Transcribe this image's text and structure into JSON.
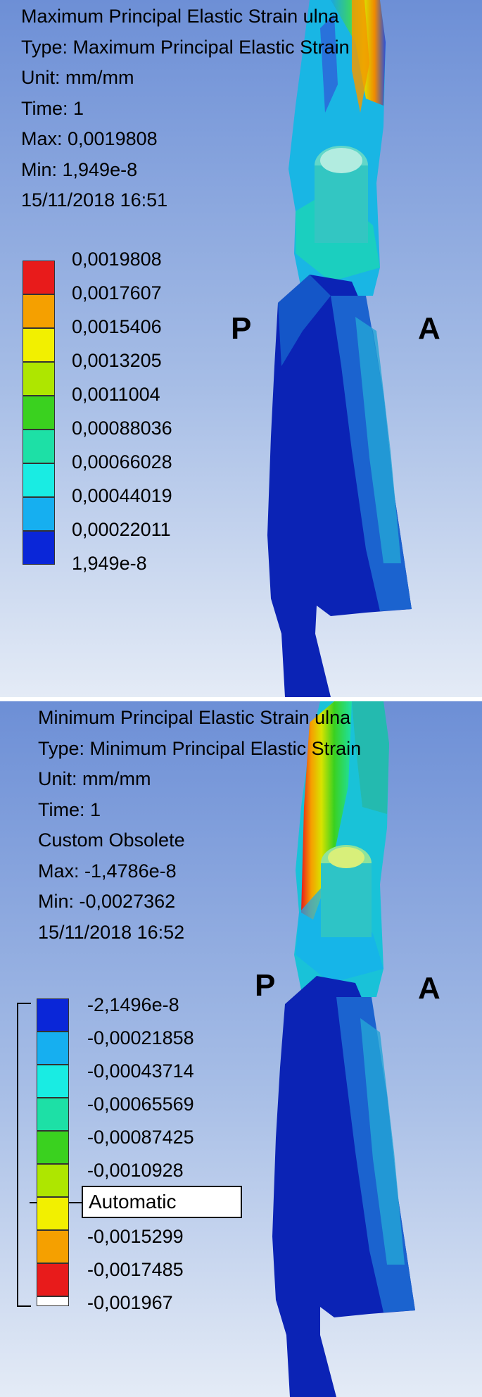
{
  "top_plot": {
    "title": "Maximum Principal Elastic Strain ulna",
    "type_line": "Type: Maximum Principal Elastic Strain",
    "unit_line": "Unit: mm/mm",
    "time_line": "Time: 1",
    "max_line": "Max: 0,0019808",
    "min_line": "Min: 1,949e-8",
    "date_line": "15/11/2018 16:51",
    "legend": [
      {
        "label": "0,0019808",
        "color": "#e81b1b"
      },
      {
        "label": "0,0017607",
        "color": "#f5a000"
      },
      {
        "label": "0,0015406",
        "color": "#f2f000"
      },
      {
        "label": "0,0013205",
        "color": "#aee600"
      },
      {
        "label": "0,0011004",
        "color": "#3ad11f"
      },
      {
        "label": "0,00088036",
        "color": "#1de0a6"
      },
      {
        "label": "0,00066028",
        "color": "#19ece3"
      },
      {
        "label": "0,00044019",
        "color": "#16aff0"
      },
      {
        "label": "0,00022011",
        "color": "#0a26d8"
      },
      {
        "label": "1,949e-8",
        "color": null
      }
    ],
    "direction_left": "P",
    "direction_right": "A"
  },
  "bottom_plot": {
    "title": "Minimum Principal Elastic Strain ulna",
    "type_line": "Type: Minimum Principal Elastic Strain",
    "unit_line": "Unit: mm/mm",
    "time_line": "Time: 1",
    "custom_line": "Custom Obsolete",
    "max_line": "Max: -1,4786e-8",
    "min_line": "Min: -0,0027362",
    "date_line": "15/11/2018 16:52",
    "legend": [
      {
        "label": "-2,1496e-8",
        "color": "#0a26d8"
      },
      {
        "label": "-0,00021858",
        "color": "#16aff0"
      },
      {
        "label": "-0,00043714",
        "color": "#19ece3"
      },
      {
        "label": "-0,00065569",
        "color": "#1de0a6"
      },
      {
        "label": "-0,00087425",
        "color": "#3ad11f"
      },
      {
        "label": "-0,0010928",
        "color": "#aee600"
      },
      {
        "label": "",
        "color": "#f2f000"
      },
      {
        "label": "-0,0015299",
        "color": "#f5a000"
      },
      {
        "label": "-0,0017485",
        "color": "#e81b1b"
      },
      {
        "label": "-0,001967",
        "color": "#ffffff"
      }
    ],
    "edit_box_value": "Automatic",
    "direction_left": "P",
    "direction_right": "A"
  }
}
